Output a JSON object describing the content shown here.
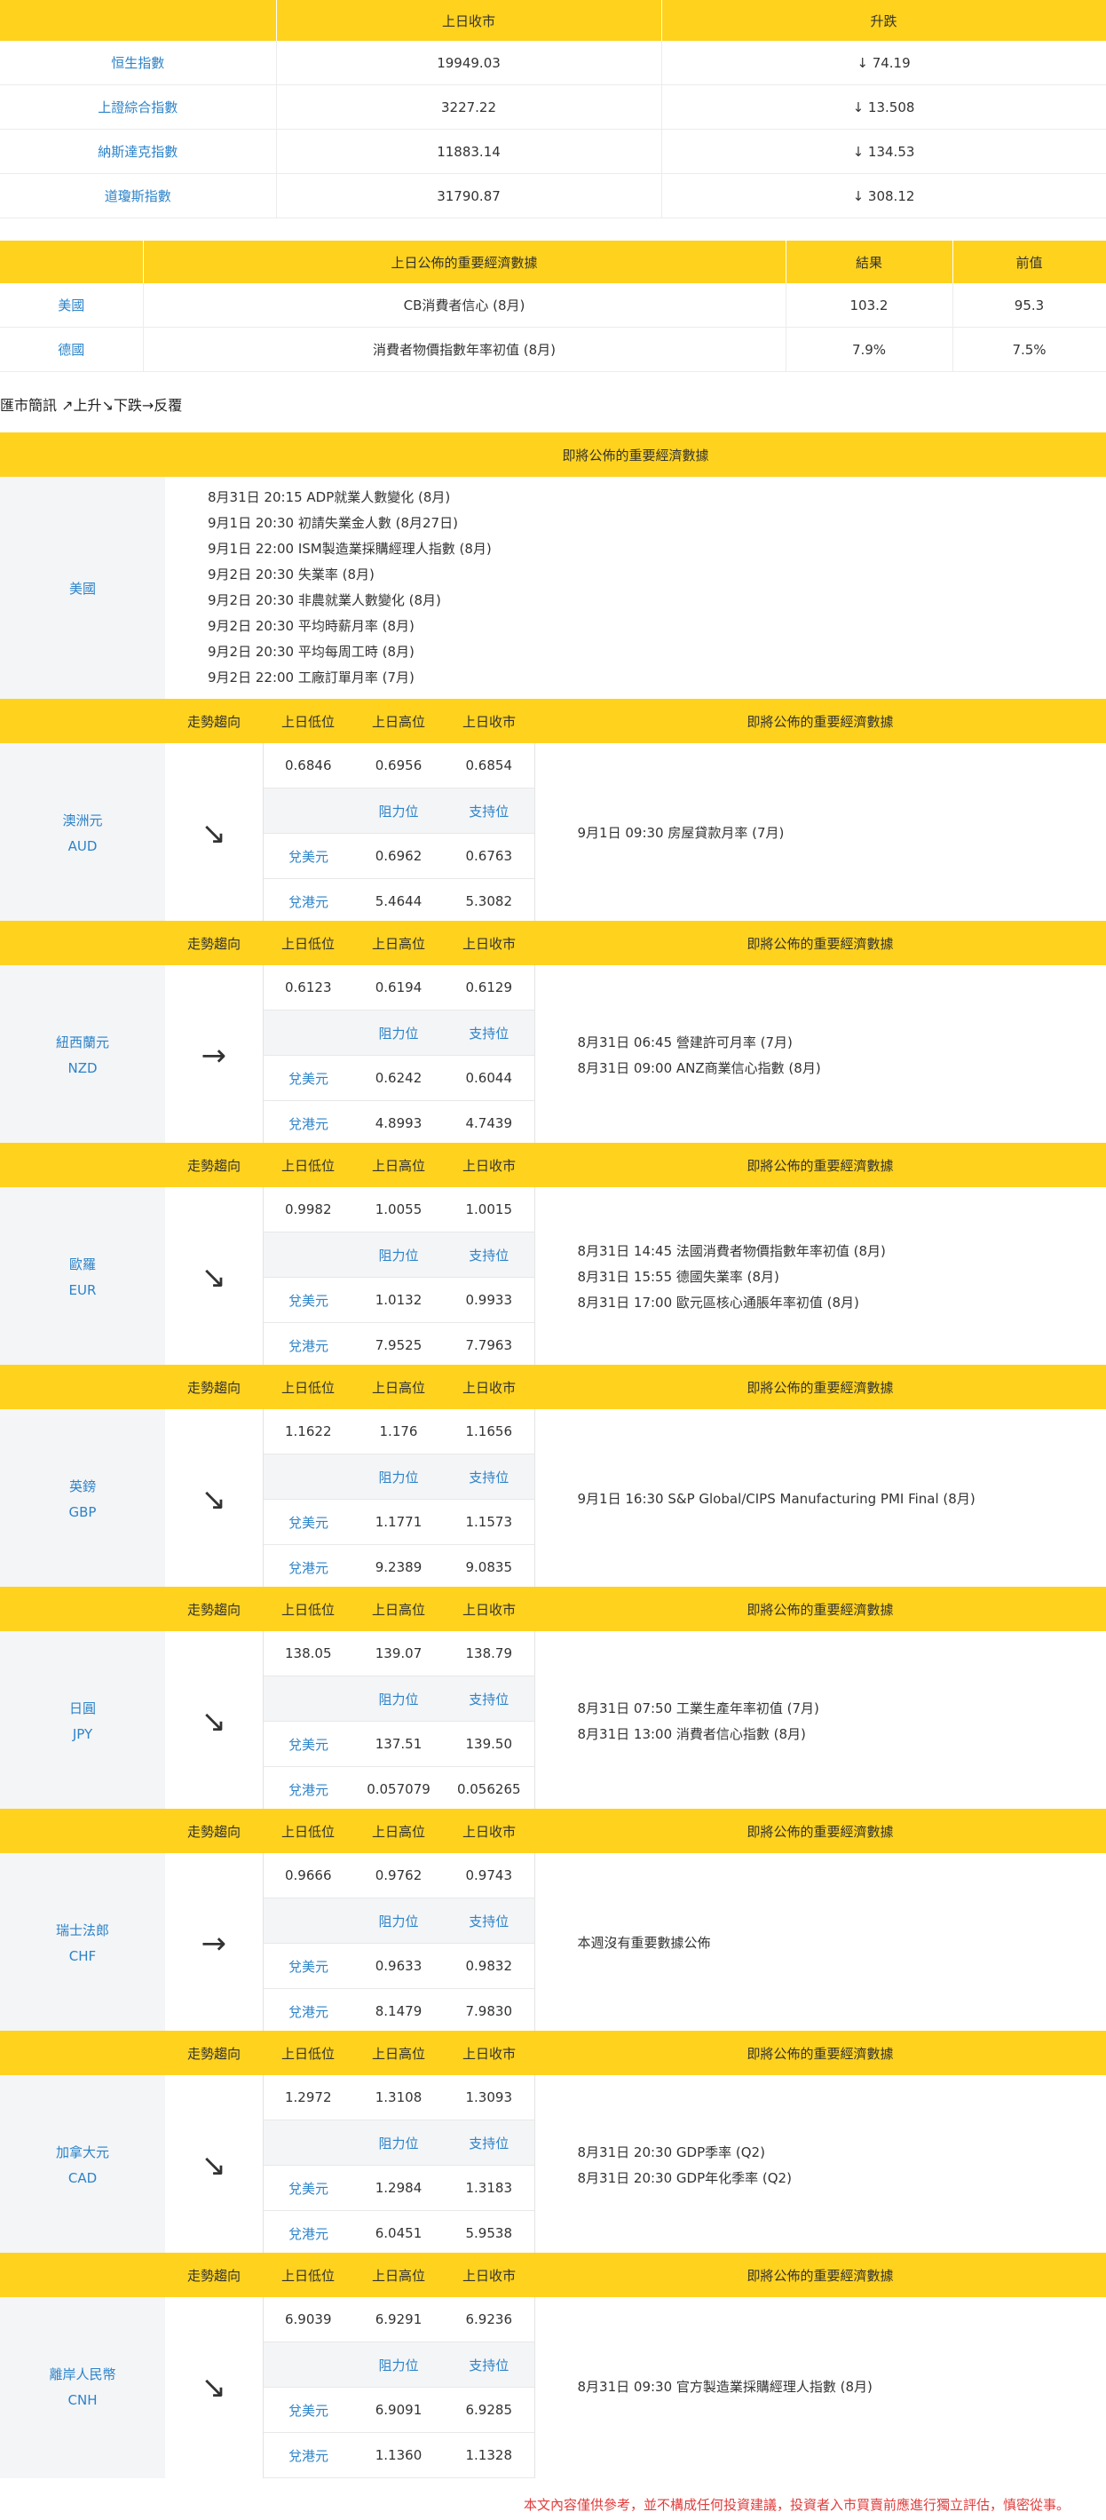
{
  "index_table": {
    "headers": [
      "",
      "上日收市",
      "升跌"
    ],
    "rows": [
      {
        "name": "恒生指數",
        "close": "19949.03",
        "change": "↓ 74.19"
      },
      {
        "name": "上證綜合指數",
        "close": "3227.22",
        "change": "↓ 13.508"
      },
      {
        "name": "納斯達克指數",
        "close": "11883.14",
        "change": "↓ 134.53"
      },
      {
        "name": "道瓊斯指數",
        "close": "31790.87",
        "change": "↓ 308.12"
      }
    ]
  },
  "published_table": {
    "headers": [
      "",
      "上日公佈的重要經濟數據",
      "結果",
      "前值"
    ],
    "rows": [
      {
        "country": "美國",
        "item": "CB消費者信心 (8月)",
        "result": "103.2",
        "previous": "95.3"
      },
      {
        "country": "德國",
        "item": "消費者物價指數年率初值 (8月)",
        "result": "7.9%",
        "previous": "7.5%"
      }
    ]
  },
  "legend": "匯市簡訊 ↗上升↘下跌→反覆",
  "us_upcoming": {
    "header": "即將公佈的重要經濟數據",
    "country": "美國",
    "events": [
      "8月31日 20:15 ADP就業人數變化 (8月)",
      "9月1日 20:30 初請失業金人數 (8月27日)",
      "9月1日 22:00 ISM製造業採購經理人指數 (8月)",
      "9月2日 20:30 失業率 (8月)",
      "9月2日 20:30 非農就業人數變化 (8月)",
      "9月2日 20:30 平均時薪月率 (8月)",
      "9月2日 20:30 平均每周工時 (8月)",
      "9月2日 22:00 工廠訂單月率 (7月)"
    ]
  },
  "currency_headers": {
    "trend": "走勢趨向",
    "low": "上日低位",
    "high": "上日高位",
    "close": "上日收市",
    "events": "即將公佈的重要經濟數據",
    "resistance": "阻力位",
    "support": "支持位",
    "usd_label": "兌美元",
    "hkd_label": "兌港元"
  },
  "currencies": [
    {
      "name": "澳洲元",
      "code": "AUD",
      "trend": "↘",
      "low": "0.6846",
      "high": "0.6956",
      "close": "0.6854",
      "usd_res": "0.6962",
      "usd_sup": "0.6763",
      "hkd_res": "5.4644",
      "hkd_sup": "5.3082",
      "events": [
        "9月1日 09:30 房屋貸款月率 (7月)"
      ]
    },
    {
      "name": "紐西蘭元",
      "code": "NZD",
      "trend": "→",
      "low": "0.6123",
      "high": "0.6194",
      "close": "0.6129",
      "usd_res": "0.6242",
      "usd_sup": "0.6044",
      "hkd_res": "4.8993",
      "hkd_sup": "4.7439",
      "events": [
        "8月31日 06:45 營建許可月率 (7月)",
        "8月31日 09:00 ANZ商業信心指數 (8月)"
      ]
    },
    {
      "name": "歐羅",
      "code": "EUR",
      "trend": "↘",
      "low": "0.9982",
      "high": "1.0055",
      "close": "1.0015",
      "usd_res": "1.0132",
      "usd_sup": "0.9933",
      "hkd_res": "7.9525",
      "hkd_sup": "7.7963",
      "events": [
        "8月31日 14:45  法國消費者物價指數年率初值 (8月)",
        "8月31日 15:55  德國失業率 (8月)",
        "8月31日 17:00  歐元區核心通脹年率初值 (8月)"
      ]
    },
    {
      "name": "英鎊",
      "code": "GBP",
      "trend": "↘",
      "low": "1.1622",
      "high": "1.176",
      "close": "1.1656",
      "usd_res": "1.1771",
      "usd_sup": "1.1573",
      "hkd_res": "9.2389",
      "hkd_sup": "9.0835",
      "events": [
        "9月1日 16:30 S&P Global/CIPS Manufacturing PMI Final (8月)"
      ]
    },
    {
      "name": "日圓",
      "code": "JPY",
      "trend": "↘",
      "low": "138.05",
      "high": "139.07",
      "close": "138.79",
      "usd_res": "137.51",
      "usd_sup": "139.50",
      "hkd_res": "0.057079",
      "hkd_sup": "0.056265",
      "events": [
        "8月31日 07:50 工業生產年率初值 (7月)",
        "8月31日 13:00 消費者信心指數 (8月)"
      ]
    },
    {
      "name": "瑞士法郎",
      "code": "CHF",
      "trend": "→",
      "low": "0.9666",
      "high": "0.9762",
      "close": "0.9743",
      "usd_res": "0.9633",
      "usd_sup": "0.9832",
      "hkd_res": "8.1479",
      "hkd_sup": "7.9830",
      "events": [
        "本週沒有重要數據公佈"
      ]
    },
    {
      "name": "加拿大元",
      "code": "CAD",
      "trend": "↘",
      "low": "1.2972",
      "high": "1.3108",
      "close": "1.3093",
      "usd_res": "1.2984",
      "usd_sup": "1.3183",
      "hkd_res": "6.0451",
      "hkd_sup": "5.9538",
      "events": [
        "8月31日 20:30 GDP季率 (Q2)",
        "8月31日 20:30 GDP年化季率 (Q2)"
      ]
    },
    {
      "name": "離岸人民幣",
      "code": "CNH",
      "trend": "↘",
      "low": "6.9039",
      "high": "6.9291",
      "close": "6.9236",
      "usd_res": "6.9091",
      "usd_sup": "6.9285",
      "hkd_res": "1.1360",
      "hkd_sup": "1.1328",
      "events": [
        "8月31日 09:30 官方製造業採購經理人指數 (8月)"
      ]
    }
  ],
  "disclaimer": "本文內容僅供參考，並不構成任何投資建議，投資者入市買賣前應進行獨立評估，慎密從事。",
  "colors": {
    "header_bg": "#FFD21E",
    "link_blue": "#2C83C9",
    "row_gray": "#F4F5F7",
    "warning_red": "#E03C3C"
  }
}
